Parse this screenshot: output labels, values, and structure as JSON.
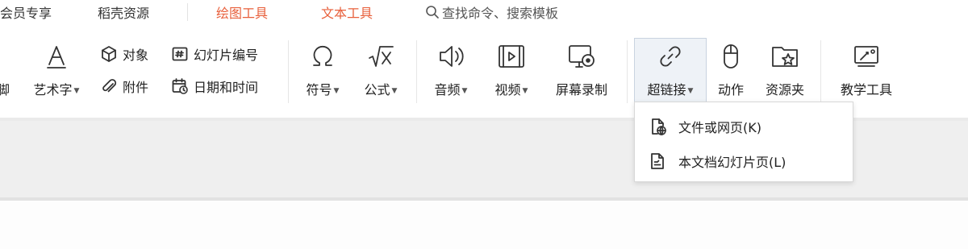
{
  "tabs": {
    "member": "会员专享",
    "shell": "稻壳资源",
    "draw_tools": "绘图工具",
    "text_tools": "文本工具",
    "search_placeholder": "查找命令、搜索模板"
  },
  "ribbon": {
    "partial_left": "脚",
    "art_text": "艺术字",
    "object": "对象",
    "attachment": "附件",
    "slide_number": "幻灯片编号",
    "date_time": "日期和时间",
    "symbol": "符号",
    "formula": "公式",
    "audio": "音频",
    "video": "视频",
    "screen_record": "屏幕录制",
    "hyperlink": "超链接",
    "action": "动作",
    "resource": "资源夹",
    "teaching_tools": "教学工具"
  },
  "dropdown": {
    "items": [
      {
        "label": "文件或网页(K)",
        "icon": "file-web-icon"
      },
      {
        "label": "本文档幻灯片页(L)",
        "icon": "slide-page-icon"
      }
    ]
  },
  "colors": {
    "accent_tab": "#e8603c",
    "active_bg": "#eef2f7",
    "band": "#efefef"
  }
}
